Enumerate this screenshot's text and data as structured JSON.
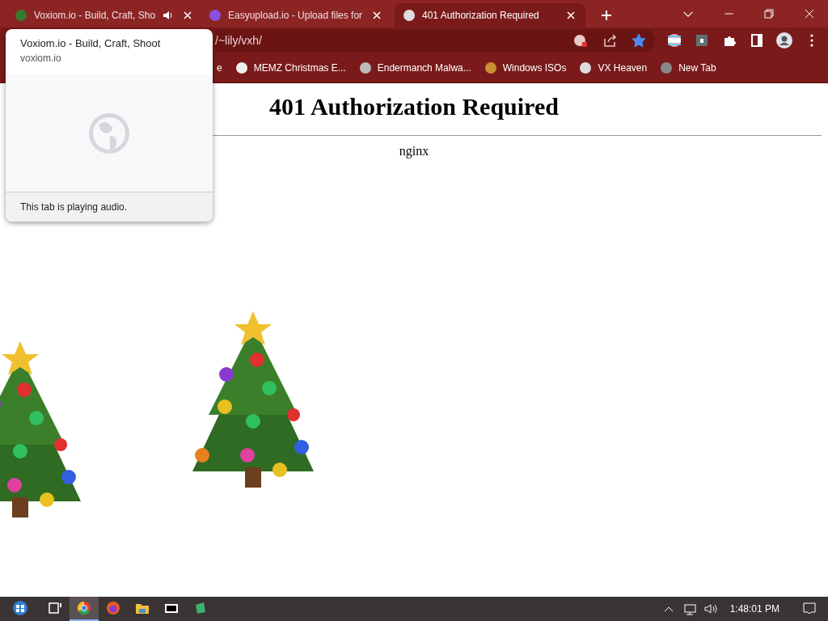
{
  "tabs": [
    {
      "title": "Voxiom.io - Build, Craft, Sho",
      "audio": true,
      "selected": false
    },
    {
      "title": "Easyupload.io - Upload files for",
      "audio": false,
      "selected": false
    },
    {
      "title": "401 Authorization Required",
      "audio": false,
      "selected": true
    }
  ],
  "omnibox": {
    "url": "/~lily/vxh/",
    "bookmarked": true
  },
  "bookmarks": [
    {
      "label": "e"
    },
    {
      "label": "MEMZ Christmas E..."
    },
    {
      "label": "Endermanch Malwa..."
    },
    {
      "label": "Windows ISOs"
    },
    {
      "label": "VX Heaven"
    },
    {
      "label": "New Tab"
    }
  ],
  "page": {
    "heading": "401 Authorization Required",
    "footer": "nginx"
  },
  "hover_card": {
    "title": "Voxiom.io - Build, Craft, Shoot",
    "domain": "voxiom.io",
    "status": "This tab is playing audio."
  },
  "taskbar": {
    "apps": [
      {
        "kind": "taskview",
        "active": false
      },
      {
        "kind": "chrome",
        "active": true
      },
      {
        "kind": "firefox",
        "active": false
      },
      {
        "kind": "explorer",
        "active": false
      },
      {
        "kind": "sevenzip",
        "active": false
      },
      {
        "kind": "app",
        "active": false
      }
    ],
    "time": "1:48:01 PM"
  }
}
